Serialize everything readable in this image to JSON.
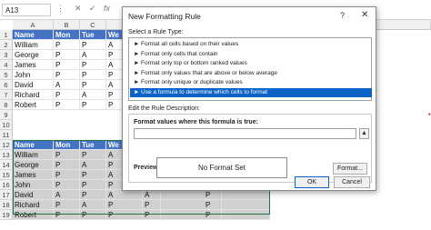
{
  "formula_bar": {
    "name_box": "A13",
    "glyphs": [
      "⋮",
      "✕",
      "✓",
      "fx"
    ]
  },
  "sheet": {
    "columns": [
      "A",
      "B",
      "C",
      "D"
    ],
    "row_numbers": [
      "1",
      "2",
      "3",
      "4",
      "5",
      "6",
      "7",
      "8",
      "9",
      "10",
      "11",
      "12",
      "13",
      "14",
      "15",
      "16",
      "17",
      "18",
      "19"
    ],
    "table1": {
      "header": [
        "Name",
        "Mon",
        "Tue",
        "We"
      ],
      "rows": [
        [
          "William",
          "P",
          "P",
          "A"
        ],
        [
          "George",
          "P",
          "A",
          "P"
        ],
        [
          "James",
          "P",
          "P",
          "A"
        ],
        [
          "John",
          "P",
          "P",
          "P"
        ],
        [
          "David",
          "A",
          "P",
          "A"
        ],
        [
          "Richard",
          "P",
          "A",
          "P"
        ],
        [
          "Robert",
          "P",
          "P",
          "P"
        ]
      ]
    },
    "table2": {
      "header": [
        "Name",
        "Mon",
        "Tue",
        "We"
      ],
      "rows": [
        [
          "William",
          "P",
          "P",
          "A"
        ],
        [
          "George",
          "P",
          "A",
          "P"
        ],
        [
          "James",
          "P",
          "P",
          "A"
        ],
        [
          "John",
          "P",
          "P",
          "P"
        ],
        [
          "David",
          "A",
          "P",
          "A"
        ],
        [
          "Richard",
          "P",
          "A",
          "P"
        ],
        [
          "Robert",
          "P",
          "P",
          "P"
        ]
      ]
    },
    "right_cells": [
      "P",
      "A",
      "P",
      "P",
      "A",
      "P",
      "P",
      "P",
      "A",
      "P",
      "A",
      "P",
      "P",
      "P"
    ]
  },
  "dialog": {
    "title": "New Formatting Rule",
    "help": "?",
    "close": "✕",
    "select_label": "Select a Rule Type:",
    "rules": [
      "Format all cells based on their values",
      "Format only cells that contain",
      "Format only top or bottom ranked values",
      "Format only values that are above or below average",
      "Format only unique or duplicate values",
      "Use a formula to determine which cells to format"
    ],
    "selected_rule_index": 5,
    "edit_label": "Edit the Rule Description:",
    "formula_label": "Format values where this formula is true:",
    "formula_value": "",
    "preview_label": "Preview:",
    "preview_text": "No Format Set",
    "format_button": "Format...",
    "ok_button": "OK",
    "cancel_button": "Cancel"
  },
  "colors": {
    "header_blue": "#4472c4",
    "selection_green": "#217346",
    "selected_rule": "#0a64c8"
  }
}
